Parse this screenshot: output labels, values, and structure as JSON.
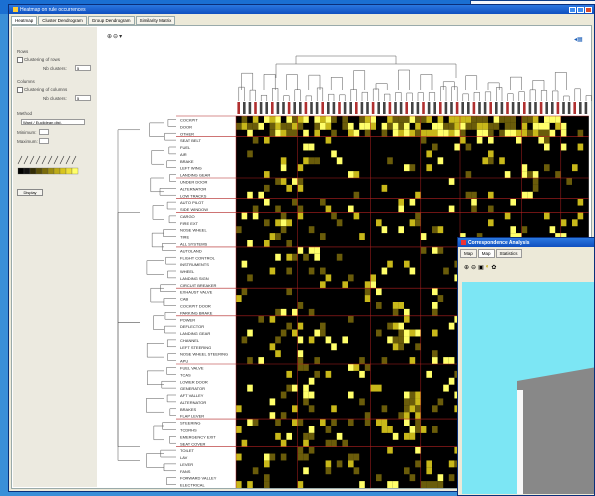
{
  "window": {
    "title": "Heatmap on rule occurrences"
  },
  "tabs": [
    {
      "label": "Heatmap",
      "active": true
    },
    {
      "label": "Cluster Dendrogram",
      "active": false
    },
    {
      "label": "Group Dendrogram",
      "active": false
    },
    {
      "label": "Similarity Matrix",
      "active": false
    }
  ],
  "sidebar": {
    "rows_heading": "Rows",
    "rows_clustering_label": "Clustering of rows",
    "rows_nb_label": "Nb clusters:",
    "rows_nb_value": "5",
    "cols_heading": "Columns",
    "cols_clustering_label": "Clustering of columns",
    "cols_nb_label": "Nb clusters:",
    "cols_nb_value": "5",
    "method_heading": "Method",
    "method_value": "Ward / Euclidean dist.",
    "minimum_label": "Minimum:",
    "maximum_label": "Maximum:",
    "apply_label": "Display"
  },
  "row_labels": [
    "COCKPIT",
    "DOOR",
    "OTHER",
    "SEAT BELT",
    "FUEL",
    "AIR",
    "BRAKE",
    "LEFT WING",
    "LANDING GEAR",
    "UNDER DOOR",
    "ALTERNATOR",
    "LOW TRACKS",
    "AUTO PILOT",
    "SIDE WINDOW",
    "CARGO",
    "FIRE EXT",
    "NOSE WHEEL",
    "TIRE",
    "ALL SYSTEMS",
    "AUTOLAND",
    "FLIGHT CONTROL",
    "INSTRUMENTS",
    "WHEEL",
    "LANDING SIGN",
    "CIRCUIT BREAKER",
    "EXHAUST VALVE",
    "CAB",
    "COCKPIT DOOR",
    "PARKING BRAKE",
    "POWER",
    "DEFLECTOR",
    "LANDING GEAR",
    "CHANNEL",
    "LEFT STEERING",
    "NOSE WHEEL STEERING",
    "APU",
    "FUEL VALVE",
    "TCAS",
    "LOWER DOOR",
    "GENERATOR",
    "AFT VALLEY",
    "ALTERNATOR",
    "BRAKES",
    "FLAP LEVER",
    "STEERING",
    "TCDRHS",
    "EMERGENCY EXIT",
    "SEAT COVER",
    "TOILET",
    "LAV",
    "LEVER",
    "FANS",
    "FORWARD VALLEY",
    "ELECTRICAL"
  ],
  "correspondence": {
    "title": "Correspondence Analysis",
    "tabs": [
      {
        "label": "Map",
        "active": false
      },
      {
        "label": "Map",
        "active": true
      },
      {
        "label": "Statistics",
        "active": false
      }
    ]
  },
  "colors": {
    "accent": "#0f4fbf",
    "heat_low": "#000000",
    "heat_high": "#ffff40",
    "grid": "#b02020"
  }
}
